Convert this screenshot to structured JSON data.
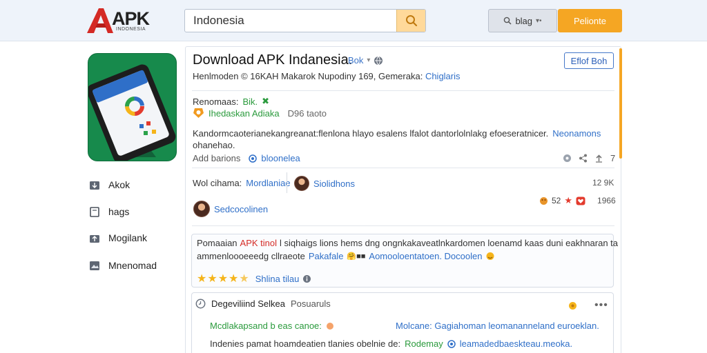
{
  "header": {
    "logo_text": "APK",
    "logo_sub": "INDONESIA",
    "search": {
      "value": "Indonesia",
      "placeholder": ""
    },
    "lang_label": "blag",
    "primary_label": "Pelionte"
  },
  "sidebar": {
    "items": [
      {
        "label": "Akok",
        "icon": "download-icon"
      },
      {
        "label": "hags",
        "icon": "file-icon"
      },
      {
        "label": "Mogilank",
        "icon": "upload-icon"
      },
      {
        "label": "Mnenomad",
        "icon": "image-icon"
      }
    ]
  },
  "app": {
    "title": "Download APK Indanesia.",
    "title_tag": "Bok",
    "action_label": "Eflof Boh",
    "meta_text": "Henlmoden  © 16KAH  Makarok  Nupodiny 169,  Gemeraka:",
    "meta_link": "Chiglaris"
  },
  "details": {
    "requirements_label": "Renomaas:",
    "requirements_value": "Bik.",
    "developer_name": "Ihedaskan Adiaka",
    "developer_count": "D96 taoto",
    "description_line1": "Kandormcaoterianekangreanat:flenlona hlayo esalens lfalot dantorlolnlakg efoeseratnicer.",
    "description_link": "Neonamons",
    "description_line2": "ohanehao.",
    "add_label": "Add barions",
    "add_link": "bloonelea",
    "counter": "7"
  },
  "users": {
    "row1_label": "Wol cihama:",
    "row1_value": "Mordlaniae",
    "row1_user": "Siolidhons",
    "row1_count": "12 9K",
    "row2_user": "Sedcocolinen",
    "row2_stats": "52",
    "row2_count": "1966"
  },
  "review": {
    "line1_prefix": "Pomaaian",
    "line1_red": "APK tinol",
    "line1_rest": "l siqhaigs lions hems dng ongnkakaveatlnkardomen loenamd kaas duni eakhnaran ta",
    "line2_start": "ammenloooeeedg cllraeote",
    "line2_link1": "Pakafale",
    "line2_link2": "Aomooloentatoen. Docoolen",
    "rating_value": 4.5,
    "rating_max": 5,
    "rating_label": "Shlina tilau"
  },
  "comment": {
    "title": "Degeviliind Selkea",
    "subtitle": "Posuaruls",
    "line1_left": "Mcdlakapsand b eas canoe:",
    "line1_right": "Molcane: Gagiahoman leomananneland euroeklan.",
    "line2_left": "Indenies pamat hoamdeatien tlanies obelnie de:",
    "line2_link1": "Rodemay",
    "line2_link2": "leamadedbaeskteau.meoka."
  },
  "colors": {
    "accent": "#f5a623",
    "link": "#2f6fc8",
    "app_icon_bg": "#178a4c",
    "logo_red": "#d42a25"
  }
}
